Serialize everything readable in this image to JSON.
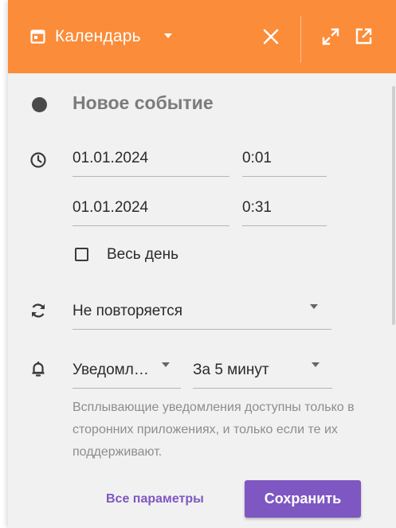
{
  "header": {
    "calendar_label": "Календарь",
    "icons": [
      "calendar-icon",
      "chevron-down-icon",
      "close-icon",
      "expand-icon",
      "external-link-icon"
    ],
    "background_color": "#fb8c39"
  },
  "event": {
    "title": "Новое событие",
    "color_dot": "#4a4a4a"
  },
  "time": {
    "start_date": "01.01.2024",
    "start_time": "0:01",
    "end_date": "01.01.2024",
    "end_time": "0:31"
  },
  "all_day": {
    "label": "Весь день",
    "checked": false
  },
  "repeat": {
    "value": "Не повторяется"
  },
  "notification": {
    "type": "Уведомл…",
    "time": "За 5 минут",
    "hint": "Всплывающие уведомления доступны только в сторонних приложениях, и только если те их поддерживают."
  },
  "footer": {
    "all_params_label": "Все параметры",
    "save_label": "Сохранить",
    "accent_color": "#7e57c2"
  }
}
